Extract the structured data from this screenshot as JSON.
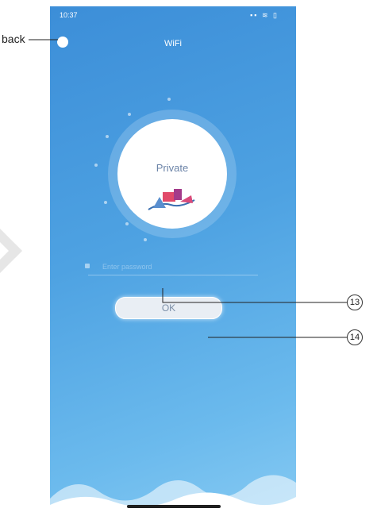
{
  "status_bar": {
    "time": "10:37",
    "signal_icons": "▪▪ ≋ ▯"
  },
  "header": {
    "title": "WiFi"
  },
  "network": {
    "name": "Private"
  },
  "password": {
    "placeholder": "Enter password"
  },
  "ok_button": {
    "label": "OK"
  },
  "annotations": {
    "back": "back",
    "callout_13": "13",
    "callout_14": "14"
  },
  "colors": {
    "background_top": "#3c8ed8",
    "background_bottom": "#85c9f2",
    "button_bg": "#e9eef4",
    "button_text": "#7c8fa8",
    "label_text": "#6c84a8"
  },
  "icons": [
    "back-icon",
    "lock-icon",
    "wifi-icon",
    "battery-icon",
    "signal-icon"
  ]
}
